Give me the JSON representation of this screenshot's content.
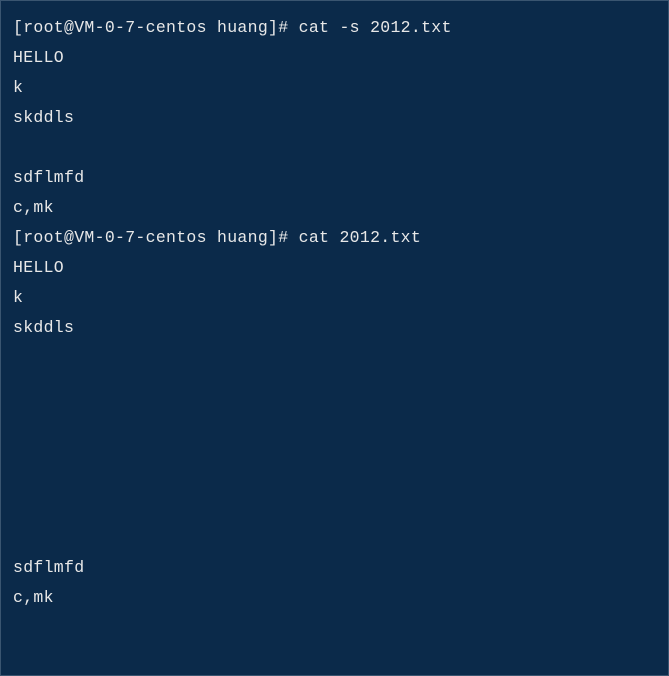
{
  "lines": [
    {
      "type": "prompt",
      "prompt": "[root@VM-0-7-centos huang]# ",
      "cmd": "cat -s 2012.txt"
    },
    {
      "type": "output",
      "text": "HELLO"
    },
    {
      "type": "output",
      "text": "k"
    },
    {
      "type": "output",
      "text": "skddls"
    },
    {
      "type": "output",
      "text": ""
    },
    {
      "type": "output",
      "text": "sdflmfd"
    },
    {
      "type": "output",
      "text": "c,mk"
    },
    {
      "type": "prompt",
      "prompt": "[root@VM-0-7-centos huang]# ",
      "cmd": "cat 2012.txt"
    },
    {
      "type": "output",
      "text": "HELLO"
    },
    {
      "type": "output",
      "text": "k"
    },
    {
      "type": "output",
      "text": "skddls"
    },
    {
      "type": "output",
      "text": ""
    },
    {
      "type": "output",
      "text": ""
    },
    {
      "type": "output",
      "text": ""
    },
    {
      "type": "output",
      "text": ""
    },
    {
      "type": "output",
      "text": ""
    },
    {
      "type": "output",
      "text": ""
    },
    {
      "type": "output",
      "text": ""
    },
    {
      "type": "output",
      "text": "sdflmfd"
    },
    {
      "type": "output",
      "text": "c,mk"
    }
  ]
}
